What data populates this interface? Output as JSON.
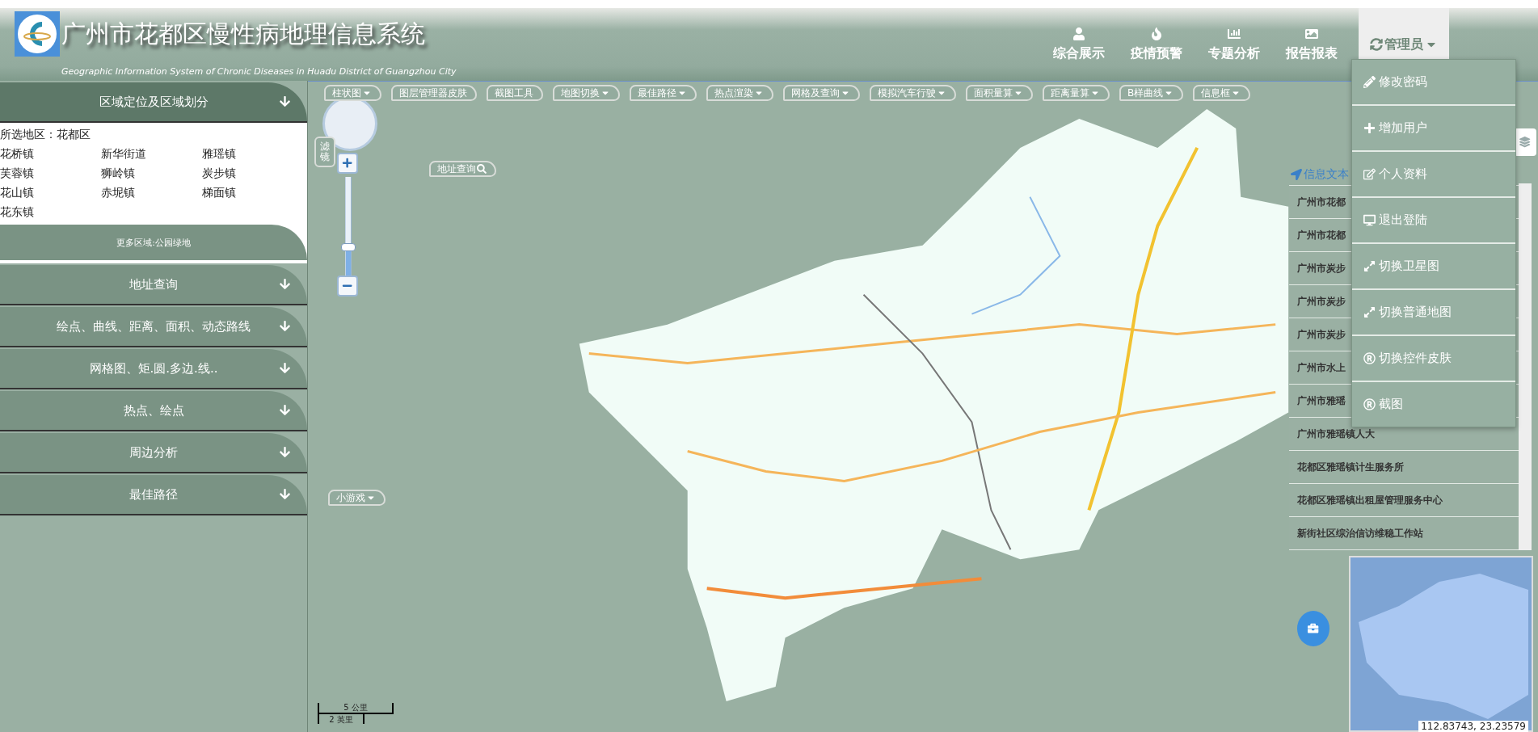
{
  "header": {
    "title": "广州市花都区慢性病地理信息系统",
    "subtitle": "Geographic Information System of Chronic Diseases in Huadu District of Guangzhou City"
  },
  "nav": [
    {
      "label": "综合展示",
      "selected": false
    },
    {
      "label": "疫情预警",
      "selected": false
    },
    {
      "label": "专题分析",
      "selected": false
    },
    {
      "label": "报告报表",
      "selected": false
    }
  ],
  "user_menu": {
    "label": "管理员",
    "expanded": true,
    "items": [
      {
        "label": "修改密码"
      },
      {
        "label": "增加用户"
      },
      {
        "label": "个人资料"
      },
      {
        "label": "退出登陆"
      },
      {
        "label": "切换卫星图"
      },
      {
        "label": "切换普通地图"
      },
      {
        "label": "切换控件皮肤"
      },
      {
        "label": "截图"
      }
    ]
  },
  "sidebar": {
    "sections": [
      {
        "title": "区域定位及区域划分",
        "expanded": true,
        "selected_area": "所选地区：花都区",
        "towns": [
          "花桥镇",
          "新华街道",
          "雅瑶镇",
          "芙蓉镇",
          "狮岭镇",
          "炭步镇",
          "花山镇",
          "赤坭镇",
          "梯面镇",
          "花东镇"
        ],
        "more_button": "更多区域:公园绿地"
      },
      {
        "title": "地址查询",
        "expanded": false
      },
      {
        "title": "绘点、曲线、距离、面积、动态路线",
        "expanded": false
      },
      {
        "title": "网格图、矩.圆.多边.线..",
        "expanded": false
      },
      {
        "title": "热点、绘点",
        "expanded": false
      },
      {
        "title": "周边分析",
        "expanded": false
      },
      {
        "title": "最佳路径",
        "expanded": false
      }
    ]
  },
  "map": {
    "toolbar": [
      {
        "label": "柱状图",
        "has_menu": true
      },
      {
        "label": "图层管理器皮肤",
        "has_menu": false
      },
      {
        "label": "截图工具",
        "has_menu": false
      },
      {
        "label": "地图切换",
        "has_menu": true
      },
      {
        "label": "最佳路径",
        "has_menu": true
      },
      {
        "label": "热点渲染",
        "has_menu": true
      },
      {
        "label": "网格及查询",
        "has_menu": true
      },
      {
        "label": "模拟汽车行驶",
        "has_menu": true
      },
      {
        "label": "面积量算",
        "has_menu": true
      },
      {
        "label": "距离量算",
        "has_menu": true
      },
      {
        "label": "B样曲线",
        "has_menu": true
      },
      {
        "label": "信息框",
        "has_menu": true
      }
    ],
    "filter_tab": "滤镜",
    "address_search": "地址查询",
    "mini_game": "小游戏",
    "zoom": {
      "level": 0.27
    },
    "scale": {
      "metric": "5 公里",
      "imperial": "2 英里"
    },
    "coordinates": "112.83743, 23.23579"
  },
  "info_panel": {
    "title": "信息文本",
    "items": [
      "广州市花都",
      "广州市花都",
      "广州市炭步",
      "广州市炭步",
      "广州市炭步",
      "广州市水上",
      "广州市雅瑶",
      "广州市雅瑶镇人大",
      "花都区雅瑶镇计生服务所",
      "花都区雅瑶镇出租屋管理服务中心",
      "新街社区综治信访维稳工作站"
    ]
  }
}
